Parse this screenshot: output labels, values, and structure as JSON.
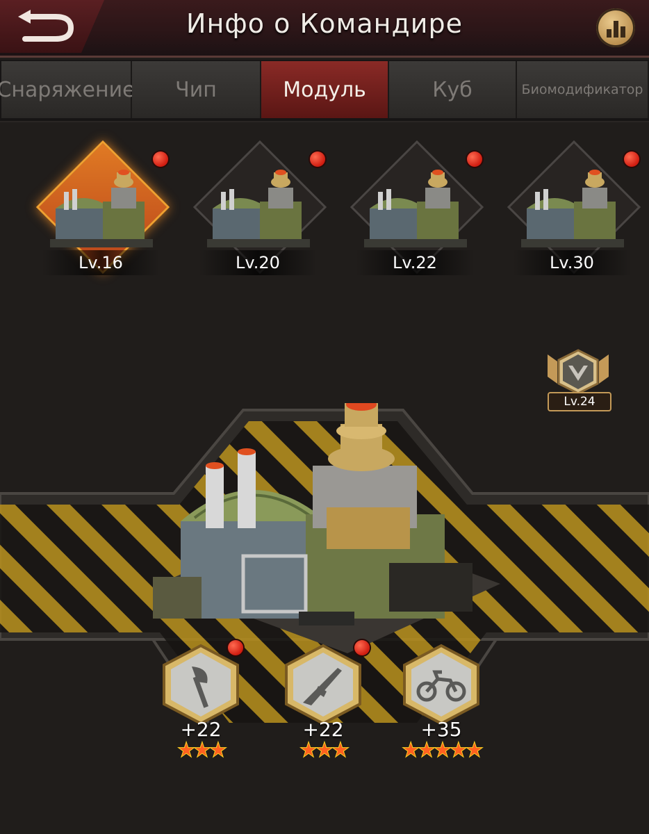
{
  "header": {
    "title": "Инфо о Командире",
    "back_icon": "back-arrow-icon",
    "stats_icon": "bar-chart-icon"
  },
  "tabs": [
    {
      "label": "Снаряжение",
      "active": false
    },
    {
      "label": "Чип",
      "active": false
    },
    {
      "label": "Модуль",
      "active": true
    },
    {
      "label": "Куб",
      "active": false
    },
    {
      "label": "Биомодификатор",
      "active": false
    }
  ],
  "modules": [
    {
      "level": "Lv.16",
      "selected": true,
      "notification": true
    },
    {
      "level": "Lv.20",
      "selected": false,
      "notification": true
    },
    {
      "level": "Lv.22",
      "selected": false,
      "notification": true
    },
    {
      "level": "Lv.30",
      "selected": false,
      "notification": true
    }
  ],
  "rank_badge": {
    "level": "Lv.24",
    "icon": "rank-chevron-icon"
  },
  "skills": [
    {
      "icon": "axe-icon",
      "value": "+22",
      "stars": 3,
      "notification": true
    },
    {
      "icon": "rifle-icon",
      "value": "+22",
      "stars": 3,
      "notification": true
    },
    {
      "icon": "motorcycle-icon",
      "value": "+35",
      "stars": 5,
      "notification": false
    }
  ],
  "colors": {
    "accent_active_tab": "#8a2a26",
    "selected_module": "#e07a24",
    "notification_dot": "#d01c10",
    "star": "#ff6020",
    "hazard_stripe": "#c89a1e"
  }
}
